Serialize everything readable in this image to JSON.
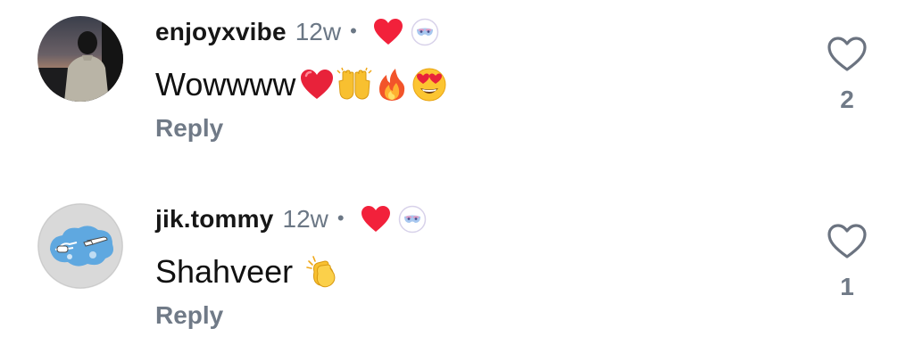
{
  "comments": [
    {
      "username": "enjoyxvibe",
      "time": "12w",
      "separator": "•",
      "text": "Wowwww",
      "emojis": [
        "red-heart-emoji",
        "raising-hands-emoji",
        "fire-emoji",
        "heart-eyes-emoji"
      ],
      "reply_label": "Reply",
      "like_count": "2",
      "creator_liked": true
    },
    {
      "username": "jik.tommy",
      "time": "12w",
      "separator": "•",
      "text": "Shahveer",
      "emojis": [
        "clapping-hands-emoji"
      ],
      "reply_label": "Reply",
      "like_count": "1",
      "creator_liked": true
    }
  ],
  "colors": {
    "username": "#161616",
    "muted": "#707a87",
    "heart_red": "#f2213b",
    "like_outline": "#6b7380"
  }
}
